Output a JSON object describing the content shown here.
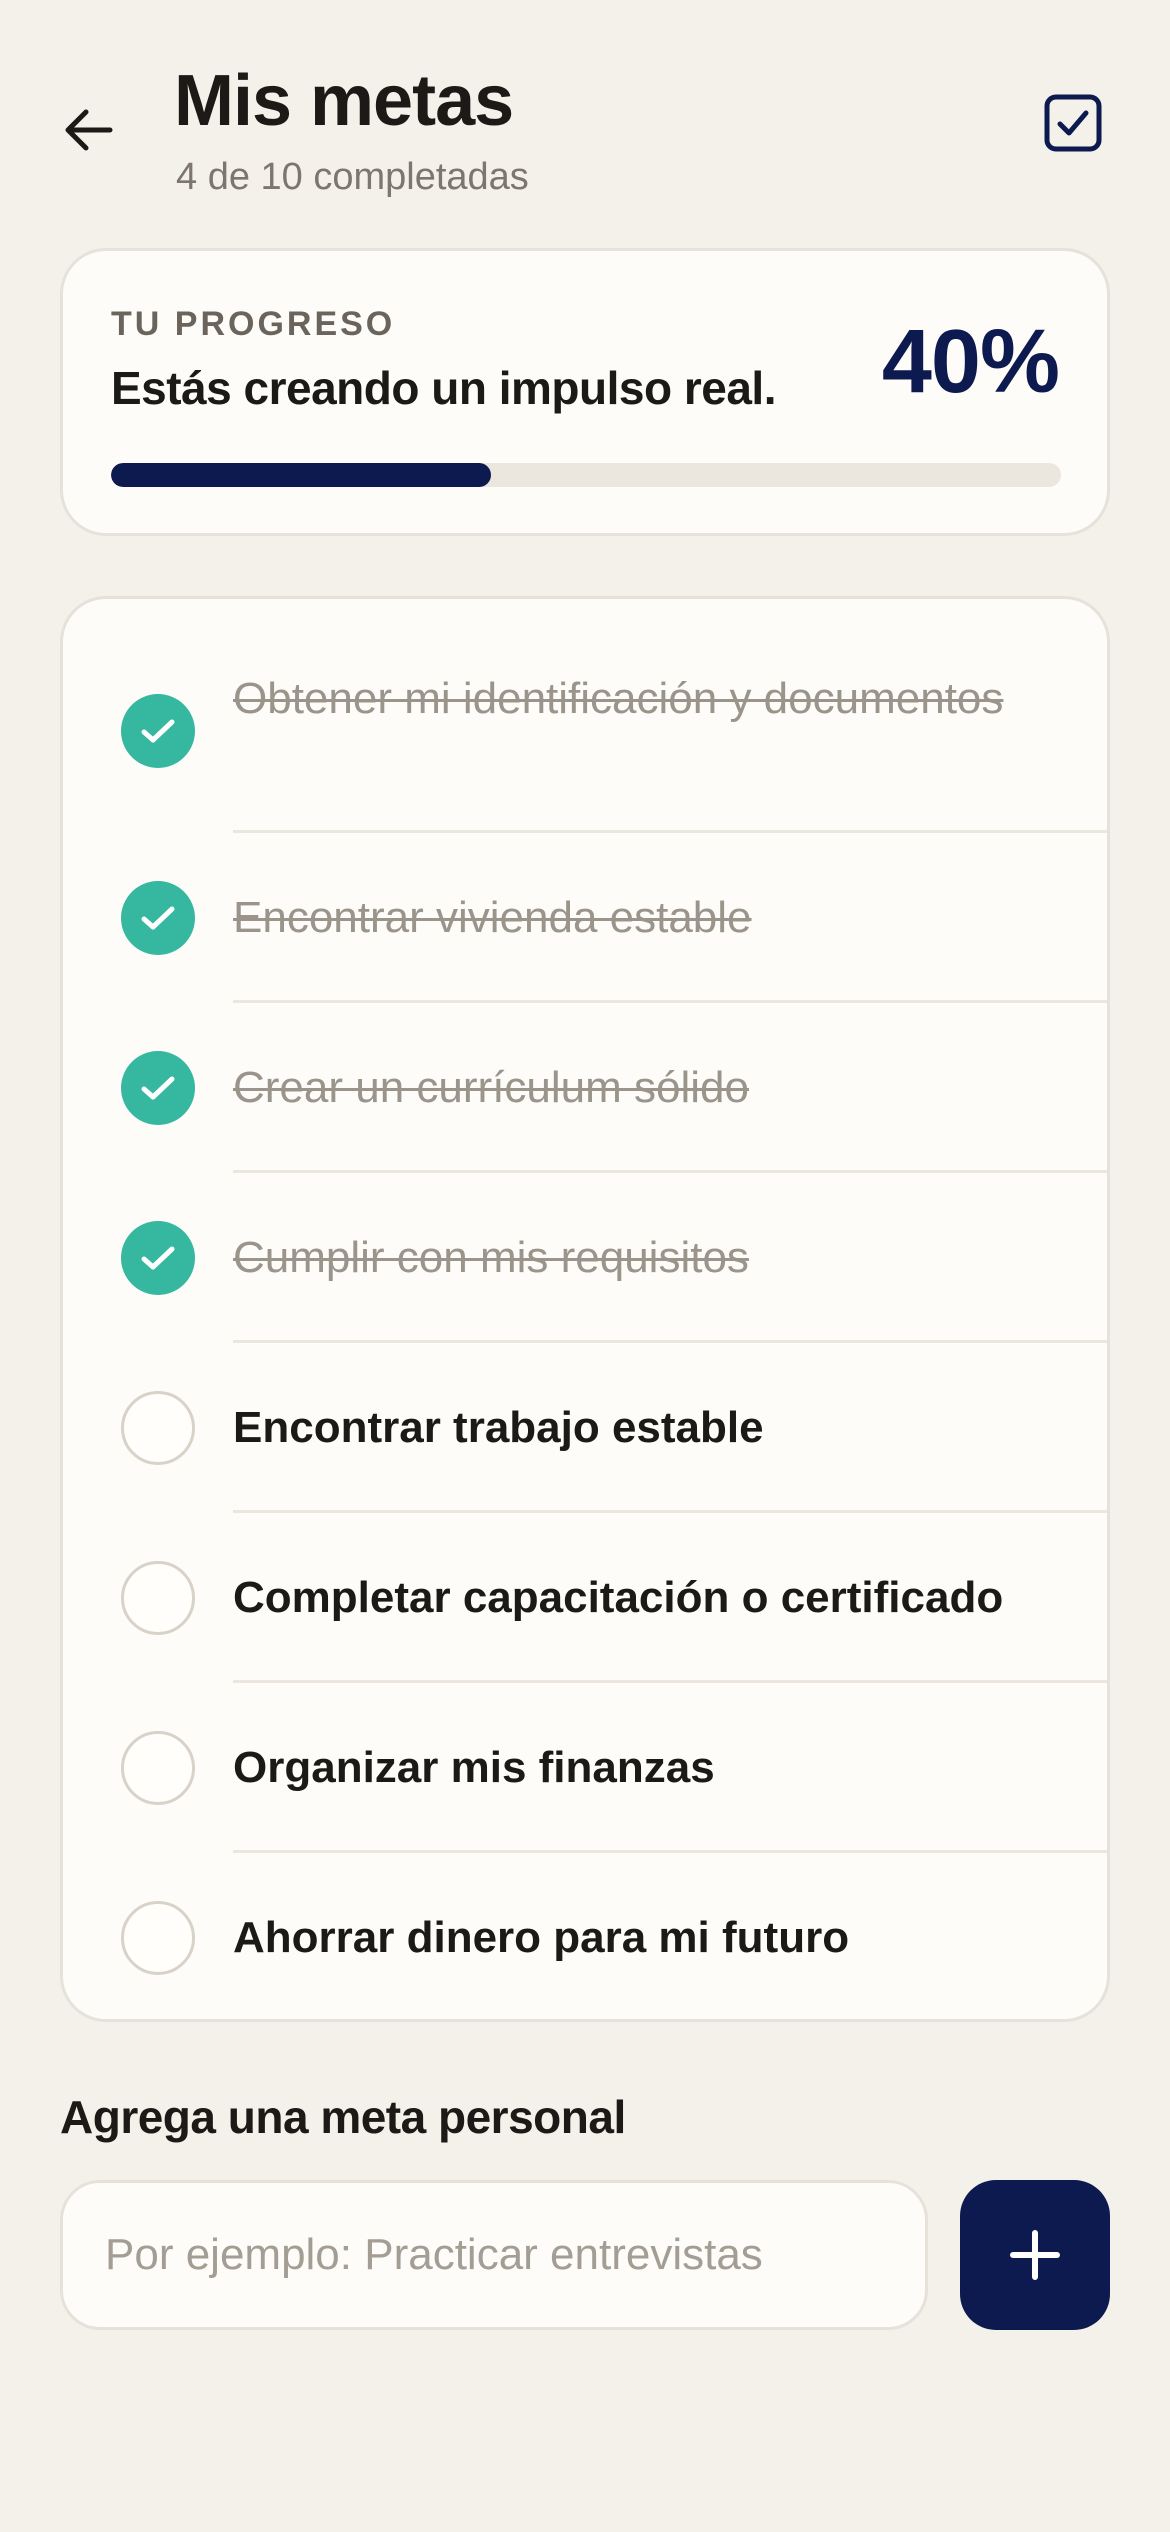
{
  "header": {
    "title": "Mis metas",
    "subtitle": "4 de 10 completadas"
  },
  "progress": {
    "kicker": "TU PROGRESO",
    "message": "Estás creando un impulso real.",
    "percent_label": "40%",
    "percent_value": 0.4
  },
  "goals": [
    {
      "label": "Obtener mi identificación y documentos",
      "completed": true
    },
    {
      "label": "Encontrar vivienda estable",
      "completed": true
    },
    {
      "label": "Crear un currículum sólido",
      "completed": true
    },
    {
      "label": "Cumplir con mis requisitos",
      "completed": true
    },
    {
      "label": "Encontrar trabajo estable",
      "completed": false
    },
    {
      "label": "Completar capacitación o certificado",
      "completed": false
    },
    {
      "label": "Organizar mis finanzas",
      "completed": false
    },
    {
      "label": "Ahorrar dinero para mi futuro",
      "completed": false
    }
  ],
  "add_goal": {
    "label": "Agrega una meta personal",
    "placeholder": "Por ejemplo: Practicar entrevistas",
    "value": ""
  },
  "icons": {
    "back": "arrow-left-icon",
    "header_action": "checkbox-icon",
    "done": "check-icon",
    "add": "plus-icon"
  },
  "colors": {
    "background": "#f4f0ea",
    "accent": "#0c1a4f",
    "done": "#35b89f",
    "muted_text": "#9a948b"
  }
}
